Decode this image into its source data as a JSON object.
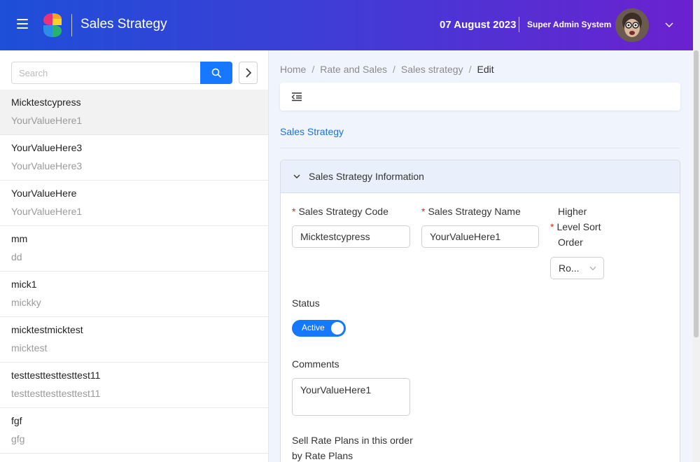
{
  "header": {
    "title": "Sales Strategy",
    "date": "07 August 2023",
    "user_name": "Super Admin System",
    "colors": {
      "gradient_start": "#1d4fd8",
      "gradient_end": "#6b21d0"
    }
  },
  "sidebar": {
    "search": {
      "placeholder": "Search",
      "value": ""
    },
    "items": [
      {
        "title": "Micktestcypress",
        "subtitle": "YourValueHere1",
        "selected": true
      },
      {
        "title": "YourValueHere3",
        "subtitle": "YourValueHere3"
      },
      {
        "title": "YourValueHere",
        "subtitle": "YourValueHere1"
      },
      {
        "title": "mm",
        "subtitle": "dd"
      },
      {
        "title": "mick1",
        "subtitle": "mickky"
      },
      {
        "title": "micktestmicktest",
        "subtitle": "micktest"
      },
      {
        "title": "testtesttesttesttest11",
        "subtitle": "testtesttesttesttest11"
      },
      {
        "title": "fgf",
        "subtitle": "gfg"
      }
    ]
  },
  "breadcrumb": [
    "Home",
    "Rate and Sales",
    "Sales strategy",
    "Edit"
  ],
  "main": {
    "section_link": "Sales Strategy",
    "panel_title": "Sales Strategy Information",
    "fields": {
      "code_label": "Sales Strategy Code",
      "code_value": "Micktestcypress",
      "name_label": "Sales Strategy Name",
      "name_value": "YourValueHere1",
      "sort_label_line1": "Higher",
      "sort_label_line2": "Level Sort",
      "sort_label_line3": "Order",
      "sort_value": "Ro...",
      "status_label": "Status",
      "status_value": "Active",
      "comments_label": "Comments",
      "comments_value": "YourValueHere1",
      "sell_label_line1": "Sell Rate Plans in this order",
      "sell_label_line2": "by Rate Plans"
    },
    "colors": {
      "accent": "#1677ff",
      "link": "#1e6fd9",
      "required": "#e02424"
    }
  }
}
